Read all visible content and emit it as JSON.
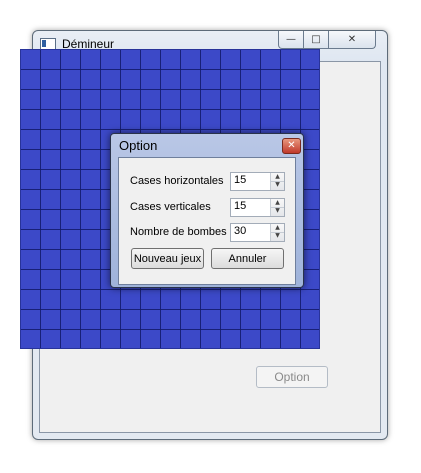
{
  "window": {
    "title": "Démineur",
    "controls": {
      "minimize": "—",
      "maximize": "□",
      "close": "✕"
    },
    "option_button": "Option"
  },
  "board": {
    "columns": 15,
    "rows": 15,
    "color": "#3c49c8"
  },
  "dialog": {
    "title": "Option",
    "close": "✕",
    "fields": {
      "horizontal": {
        "label": "Cases horizontales",
        "value": "15"
      },
      "vertical": {
        "label": "Cases verticales",
        "value": "15"
      },
      "bombs": {
        "label": "Nombre de bombes",
        "value": "30"
      }
    },
    "spin_up": "▲",
    "spin_down": "▼",
    "new_game_button": "Nouveau jeux",
    "cancel_button": "Annuler"
  }
}
